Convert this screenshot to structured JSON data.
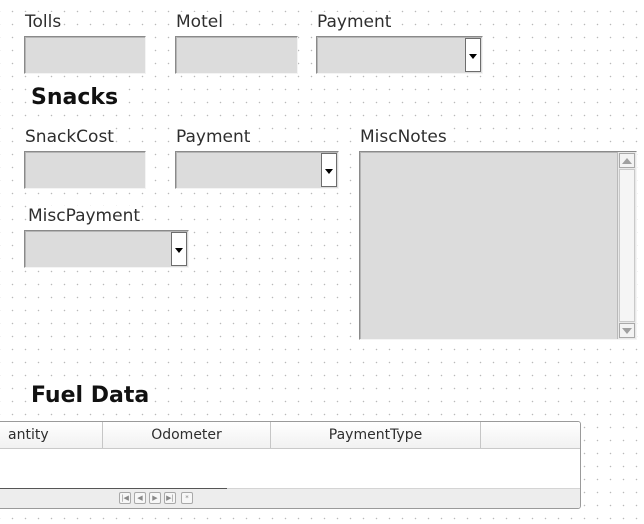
{
  "travel_section": {
    "tolls_label": "Tolls",
    "motel_label": "Motel",
    "payment_label": "Payment",
    "tolls_value": "",
    "motel_value": "",
    "payment_value": ""
  },
  "snacks_section": {
    "heading": "Snacks",
    "snack_cost_label": "SnackCost",
    "payment_label": "Payment",
    "misc_notes_label": "MiscNotes",
    "misc_payment_label": "MiscPayment",
    "snack_cost_value": "",
    "payment_value": "",
    "misc_notes_value": "",
    "misc_payment_value": ""
  },
  "fuel_section": {
    "heading": "Fuel Data",
    "grid": {
      "columns": [
        "antity",
        "Odometer",
        "PaymentType"
      ],
      "rows": []
    },
    "navigation": {
      "buttons": [
        "first-record",
        "previous-record",
        "next-record",
        "last-record",
        "new-record"
      ]
    }
  }
}
